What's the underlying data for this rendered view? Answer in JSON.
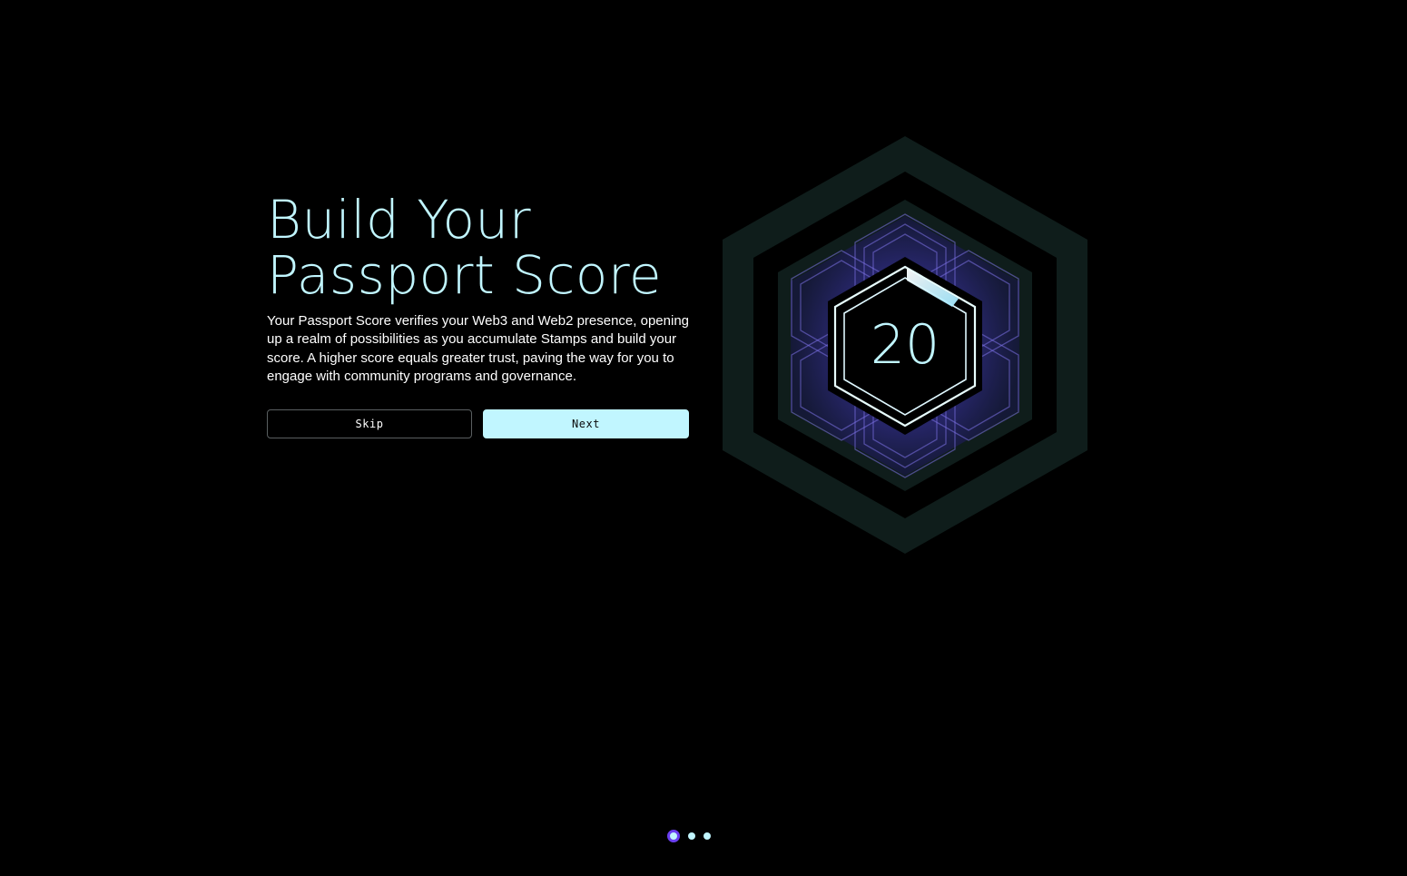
{
  "onboarding": {
    "headline_line1": "Build Your",
    "headline_line2": "Passport Score",
    "description": "Your Passport Score verifies your Web3 and Web2 presence, opening up a realm of possibilities as you accumulate Stamps and build your score. A higher score equals greater trust, paving the way for you to engage with community programs and governance.",
    "skip_label": "Skip",
    "next_label": "Next",
    "score_value": "20",
    "score_progress": 0.2,
    "current_step": 1,
    "total_steps": 3
  },
  "icons": {
    "score_graphic": "hexagon-score-icon"
  },
  "colors": {
    "background": "#000000",
    "accent": "#c1f6ff",
    "active_step": "#6a3ff0",
    "hex_glow": "#4b3fb8",
    "outer_hex": "#0e1c1a"
  }
}
